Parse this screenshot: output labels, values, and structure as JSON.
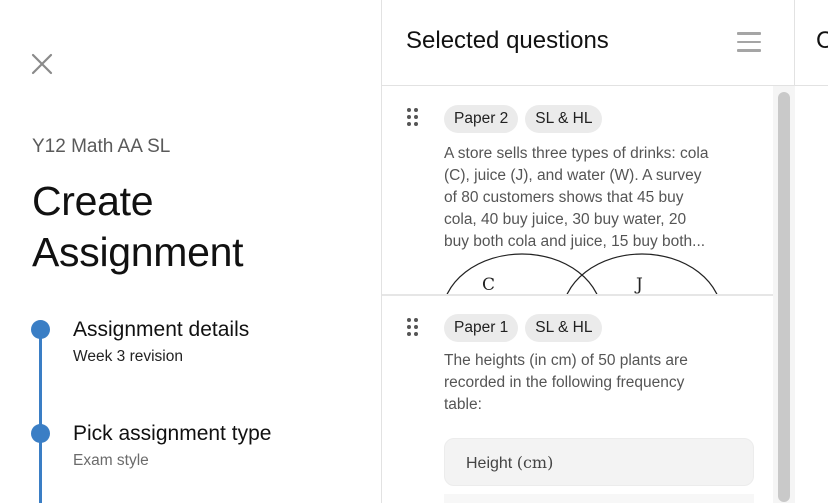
{
  "left_panel": {
    "close_icon": "close-icon",
    "course": "Y12 Math AA SL",
    "title_line1": "Create",
    "title_line2": "Assignment",
    "steps": [
      {
        "title": "Assignment details",
        "subtitle": "Week 3 revision",
        "subtitle_color": "#222222"
      },
      {
        "title": "Pick assignment type",
        "subtitle": "Exam style",
        "subtitle_color": "#6b6b6b"
      }
    ],
    "accent_color": "#3a7ec5"
  },
  "selected_panel": {
    "title": "Selected questions",
    "menu_icon": "hamburger-menu-icon",
    "questions": [
      {
        "tags": [
          "Paper 2",
          "SL & HL"
        ],
        "text_lines": [
          "A store sells three types of drinks: cola",
          "(C), juice (J), and water (W). A survey",
          "of 80 customers shows that 45 buy",
          "cola, 40 buy juice, 30 buy water, 20",
          "buy both cola and juice, 15 buy both..."
        ],
        "venn_labels": [
          "C",
          "J"
        ]
      },
      {
        "tags": [
          "Paper 1",
          "SL & HL"
        ],
        "text_lines": [
          "The heights (in cm) of 50 plants are",
          "recorded in the following frequency",
          "table:"
        ],
        "table_header": "Height",
        "table_header_unit": "(cm)"
      }
    ]
  },
  "right_panel": {
    "title_partial": "C"
  }
}
